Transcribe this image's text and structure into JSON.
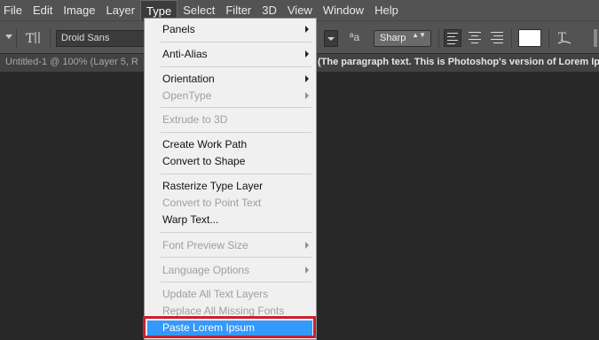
{
  "menubar": {
    "items": [
      "File",
      "Edit",
      "Image",
      "Layer",
      "Type",
      "Select",
      "Filter",
      "3D",
      "View",
      "Window",
      "Help"
    ],
    "active": "Type"
  },
  "options": {
    "font_family": "Droid Sans",
    "antialias": "Sharp",
    "antialias_arrows": "▲▼",
    "aa_glyph": "ªa",
    "text_color": "#ffffff"
  },
  "document_tab": {
    "title": "Untitled-1 @ 100% (Layer 5, R",
    "overflow_text": "(The paragraph text. This is Photoshop's version  of Lorem Ip"
  },
  "type_menu": {
    "items": [
      {
        "label": "Panels",
        "submenu": true,
        "disabled": false
      },
      {
        "label": "Anti-Alias",
        "submenu": true,
        "disabled": false
      },
      {
        "label": "Orientation",
        "submenu": true,
        "disabled": false
      },
      {
        "label": "OpenType",
        "submenu": true,
        "disabled": true
      },
      {
        "label": "Extrude to 3D",
        "submenu": false,
        "disabled": true
      },
      {
        "label": "Create Work Path",
        "submenu": false,
        "disabled": false
      },
      {
        "label": "Convert to Shape",
        "submenu": false,
        "disabled": false
      },
      {
        "label": "Rasterize Type Layer",
        "submenu": false,
        "disabled": false
      },
      {
        "label": "Convert to Point Text",
        "submenu": false,
        "disabled": true
      },
      {
        "label": "Warp Text...",
        "submenu": false,
        "disabled": false
      },
      {
        "label": "Font Preview Size",
        "submenu": true,
        "disabled": true
      },
      {
        "label": "Language Options",
        "submenu": true,
        "disabled": true
      },
      {
        "label": "Update All Text Layers",
        "submenu": false,
        "disabled": true
      },
      {
        "label": "Replace All Missing Fonts",
        "submenu": false,
        "disabled": true
      },
      {
        "label": "Paste Lorem Ipsum",
        "submenu": false,
        "disabled": false,
        "highlighted": true
      }
    ]
  },
  "colors": {
    "highlight": "#3399ff",
    "callout_border": "#cc1f2f",
    "menubar_bg": "#535353",
    "canvas_bg": "#282828"
  }
}
